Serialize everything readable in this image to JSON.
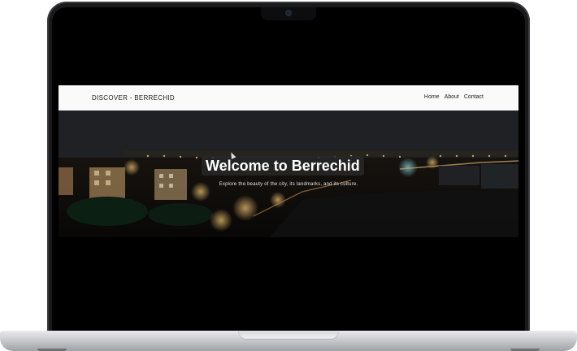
{
  "site": {
    "brand": "DISCOVER - BERRECHID",
    "nav": [
      {
        "label": "Home"
      },
      {
        "label": "About"
      },
      {
        "label": "Contact"
      }
    ],
    "hero": {
      "title": "Welcome to Berrechid",
      "subtitle": "Explore the beauty of the city, its landmarks, and its culture."
    }
  },
  "colors": {
    "navbar_bg": "#fafafa",
    "hero_text": "#ffffff",
    "laptop_body": "#1a1a1c",
    "laptop_base": "#c9cbce"
  }
}
